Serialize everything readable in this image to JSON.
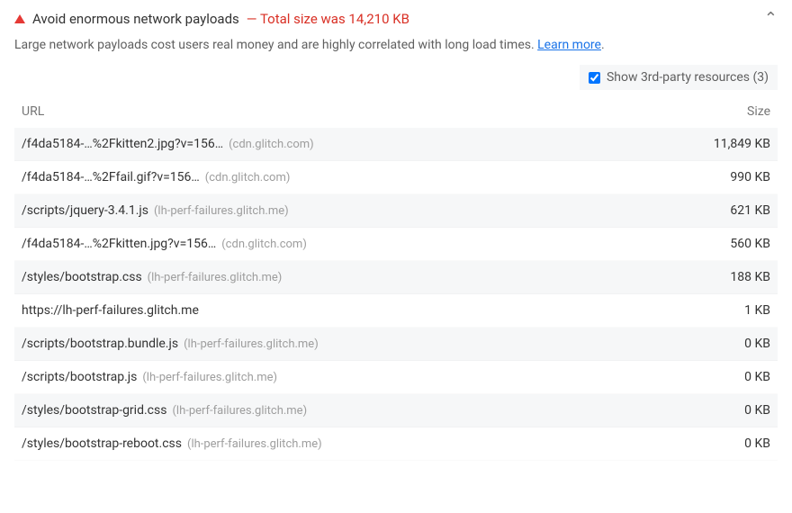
{
  "header": {
    "title": "Avoid enormous network payloads",
    "metric_prefix": " —  ",
    "metric": "Total size was 14,210 KB"
  },
  "description": "Large network payloads cost users real money and are highly correlated with long load times. ",
  "learn_more": "Learn more",
  "thirdparty": {
    "label": "Show 3rd-party resources (3)",
    "checked": true
  },
  "columns": {
    "url": "URL",
    "size": "Size"
  },
  "rows": [
    {
      "url": "/f4da5184-…%2Fkitten2.jpg?v=156…",
      "origin": "(cdn.glitch.com)",
      "size": "11,849 KB"
    },
    {
      "url": "/f4da5184-…%2Ffail.gif?v=156…",
      "origin": "(cdn.glitch.com)",
      "size": "990 KB"
    },
    {
      "url": "/scripts/jquery-3.4.1.js",
      "origin": "(lh-perf-failures.glitch.me)",
      "size": "621 KB"
    },
    {
      "url": "/f4da5184-…%2Fkitten.jpg?v=156…",
      "origin": "(cdn.glitch.com)",
      "size": "560 KB"
    },
    {
      "url": "/styles/bootstrap.css",
      "origin": "(lh-perf-failures.glitch.me)",
      "size": "188 KB"
    },
    {
      "url": "https://lh-perf-failures.glitch.me",
      "origin": "",
      "size": "1 KB"
    },
    {
      "url": "/scripts/bootstrap.bundle.js",
      "origin": "(lh-perf-failures.glitch.me)",
      "size": "0 KB"
    },
    {
      "url": "/scripts/bootstrap.js",
      "origin": "(lh-perf-failures.glitch.me)",
      "size": "0 KB"
    },
    {
      "url": "/styles/bootstrap-grid.css",
      "origin": "(lh-perf-failures.glitch.me)",
      "size": "0 KB"
    },
    {
      "url": "/styles/bootstrap-reboot.css",
      "origin": "(lh-perf-failures.glitch.me)",
      "size": "0 KB"
    }
  ]
}
